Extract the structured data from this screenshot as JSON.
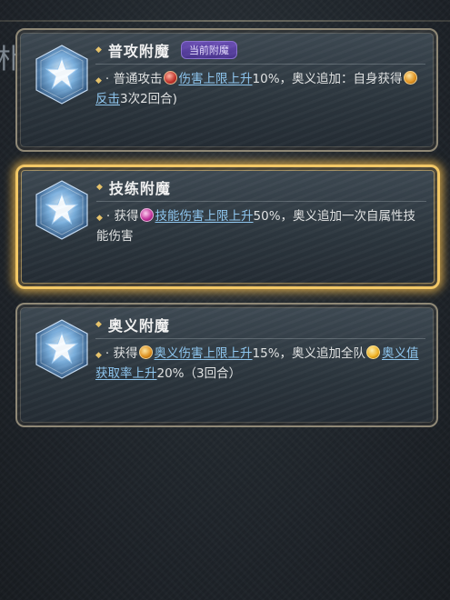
{
  "side_glyph": "朴",
  "cards": [
    {
      "title": "普攻附魔",
      "badge": "当前附魔",
      "selected": false,
      "desc": {
        "bullet": "·",
        "p1": "普通攻击",
        "icon1": "damage-cap-icon",
        "kw1": "伤害上限上升",
        "p2": "10%，奥义追加：自身获得",
        "icon2": "counter-icon",
        "kw2": "反击",
        "p3": "3次2回合)"
      }
    },
    {
      "title": "技练附魔",
      "selected": true,
      "desc": {
        "bullet": "·",
        "p1": "获得",
        "icon1": "skill-damage-cap-icon",
        "kw1": "技能伤害上限上升",
        "p2": "50%，奥义追加一次自属性技能伤害"
      }
    },
    {
      "title": "奥义附魔",
      "selected": false,
      "desc": {
        "bullet": "·",
        "p1": "获得",
        "icon1": "ougi-damage-cap-icon",
        "kw1": "奥义伤害上限上升",
        "p2": "15%，奥义追加全队",
        "icon2": "ougi-gauge-icon",
        "kw2": "奥义值获取率上升",
        "p3": "20%（3回合）"
      }
    }
  ],
  "colors": {
    "card_border": "#8f8876",
    "selected_glow": "#f2c766",
    "keyword": "#8fc8f2",
    "badge_bg": "#5a41a0",
    "diamond": "#e8c46a"
  }
}
